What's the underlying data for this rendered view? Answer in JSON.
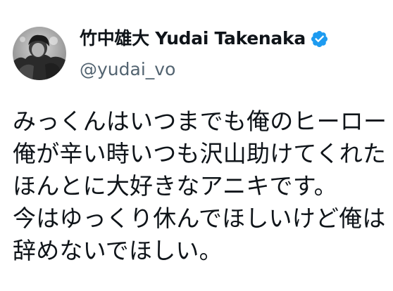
{
  "author": {
    "display_name": "竹中雄大 Yudai Takenaka",
    "handle": "@yudai_vo",
    "avatar_icon": "avatar-photo",
    "verified_icon": "verified-badge-icon",
    "verified_color": "#1d9bf0"
  },
  "tweet": {
    "lines": [
      "みっくんはいつまでも俺のヒーロー",
      "俺が辛い時いつも沢山助けてくれた",
      "ほんとに大好きなアニキです。",
      "今はゆっくり休んでほしいけど俺は",
      "辞めないでほしい。"
    ]
  },
  "colors": {
    "text": "#0f1419",
    "secondary_text": "#536471",
    "background": "#ffffff"
  }
}
